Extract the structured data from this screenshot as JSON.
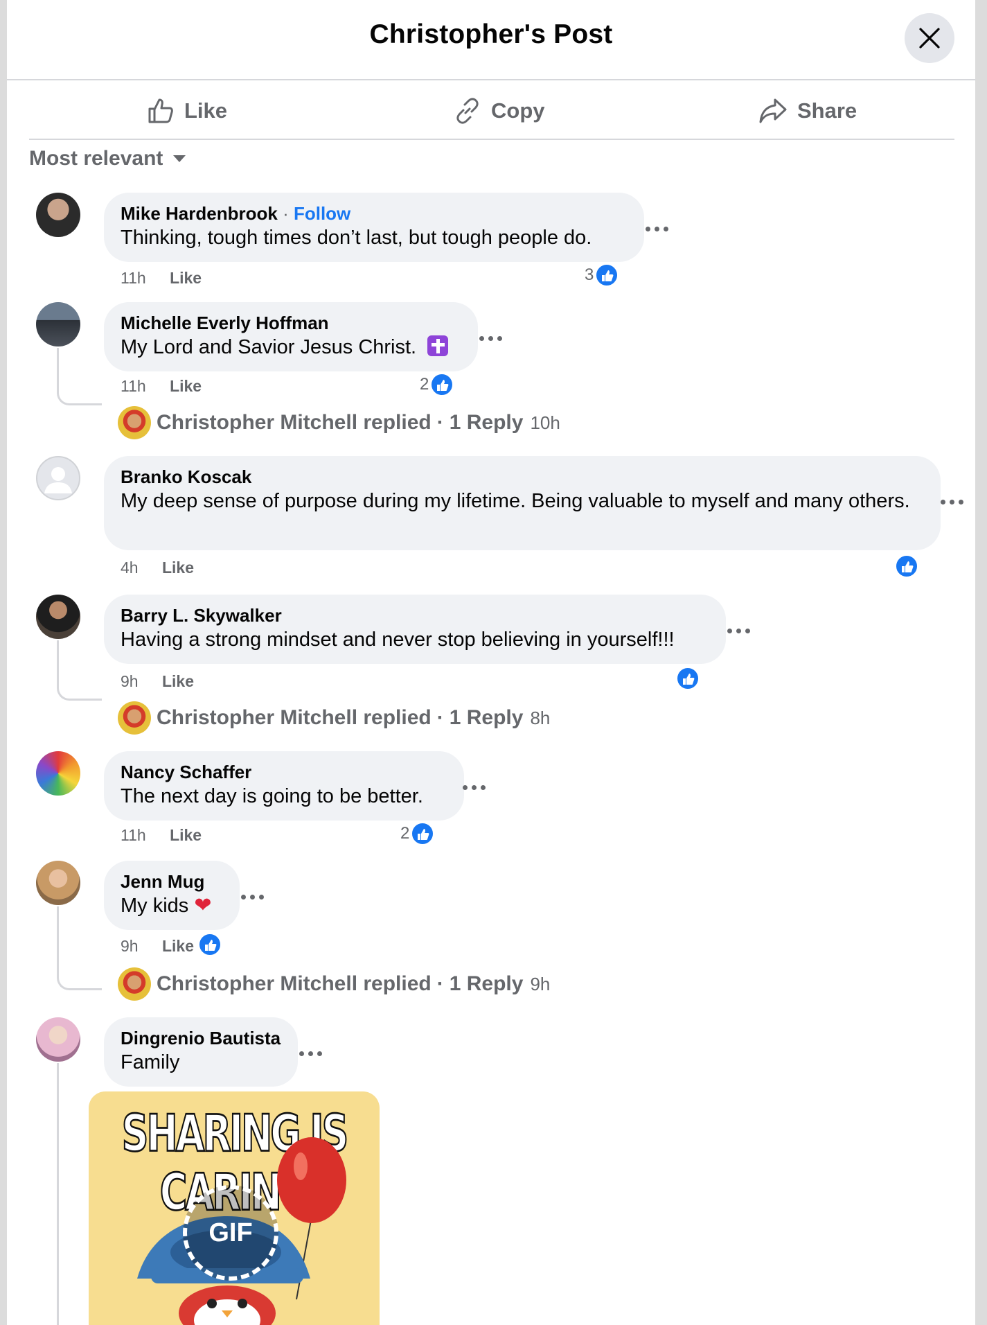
{
  "header": {
    "title": "Christopher's Post",
    "close_icon": "close-icon"
  },
  "actions": [
    {
      "label": "Like",
      "icon": "thumbs-up-icon"
    },
    {
      "label": "Copy",
      "icon": "link-icon"
    },
    {
      "label": "Share",
      "icon": "share-icon"
    }
  ],
  "sort": {
    "label": "Most relevant"
  },
  "comments": [
    {
      "name": "Mike Hardenbrook",
      "follow": "Follow",
      "text": "Thinking, tough times don’t last, but tough people do.",
      "time": "11h",
      "like": "Like",
      "reactions": "3"
    },
    {
      "name": "Michelle Everly Hoffman",
      "text": "My Lord and Savior Jesus Christ.",
      "time": "11h",
      "like": "Like",
      "reactions": "2",
      "reply": {
        "author": "Christopher Mitchell replied",
        "count": "1 Reply",
        "time": "10h"
      }
    },
    {
      "name": "Branko Koscak",
      "text": "My deep sense of purpose during my lifetime. Being valuable to myself and many others.",
      "time": "4h",
      "like": "Like",
      "reactions": ""
    },
    {
      "name": "Barry L. Skywalker",
      "text": "Having a strong mindset and never stop believing in yourself!!!",
      "time": "9h",
      "like": "Like",
      "reactions": "",
      "reply": {
        "author": "Christopher Mitchell replied",
        "count": "1 Reply",
        "time": "8h"
      }
    },
    {
      "name": "Nancy Schaffer",
      "text": "The next day is going to be better.",
      "time": "11h",
      "like": "Like",
      "reactions": "2"
    },
    {
      "name": "Jenn Mug",
      "text": "My kids",
      "time": "9h",
      "like": "Like",
      "reactions": "",
      "reply": {
        "author": "Christopher Mitchell replied",
        "count": "1 Reply",
        "time": "9h"
      }
    },
    {
      "name": "Dingrenio Bautista",
      "text": "Family",
      "gif": {
        "caption": "SHARING IS CARING",
        "badge": "GIF"
      }
    }
  ],
  "separator": "·",
  "colors": {
    "link": "#1877f2",
    "reaction": "#1877f2",
    "bubble": "#f0f2f5",
    "muted": "#65676b"
  }
}
